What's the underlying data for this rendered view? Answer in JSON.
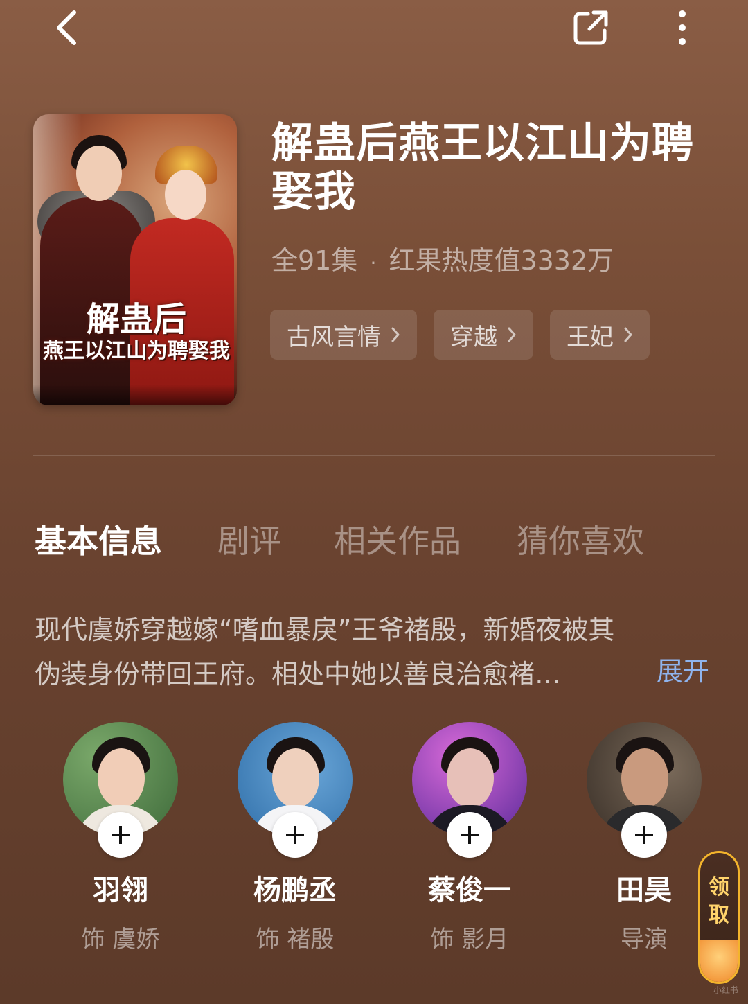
{
  "header": {
    "back_icon": "chevron-left-icon",
    "share_icon": "share-external-icon",
    "more_icon": "more-vertical-icon"
  },
  "drama": {
    "poster_title_line1": "解蛊后",
    "poster_title_line2": "燕王以江山为聘娶我",
    "title_line1": "解蛊后燕王以江山为聘",
    "title_line2": "娶我",
    "episodes": "全91集",
    "separator": "·",
    "heat": "红果热度值3332万",
    "tags": [
      {
        "label": "古风言情"
      },
      {
        "label": "穿越"
      },
      {
        "label": "王妃"
      }
    ]
  },
  "tabs": [
    {
      "label": "基本信息",
      "active": true
    },
    {
      "label": "剧评",
      "active": false
    },
    {
      "label": "相关作品",
      "active": false
    },
    {
      "label": "猜你喜欢",
      "active": false
    }
  ],
  "synopsis": {
    "line1": "现代虞娇穿越嫁“嗜血暴戾”王爷褚殷，新婚夜被其",
    "line2": "伪装身份带回王府。相处中她以善良治愈褚…",
    "expand_label": "展开"
  },
  "cast": [
    {
      "name": "羽翎",
      "role": "饰 虞娇"
    },
    {
      "name": "杨鹏丞",
      "role": "饰 褚殷"
    },
    {
      "name": "蔡俊一",
      "role": "饰 影月"
    },
    {
      "name": "田昊",
      "role": "导演"
    }
  ],
  "reward": {
    "line1": "领",
    "line2": "取"
  },
  "watermark": "小红书",
  "colors": {
    "accent_link": "#8fb4ee",
    "reward_gold": "#f3b42c"
  }
}
